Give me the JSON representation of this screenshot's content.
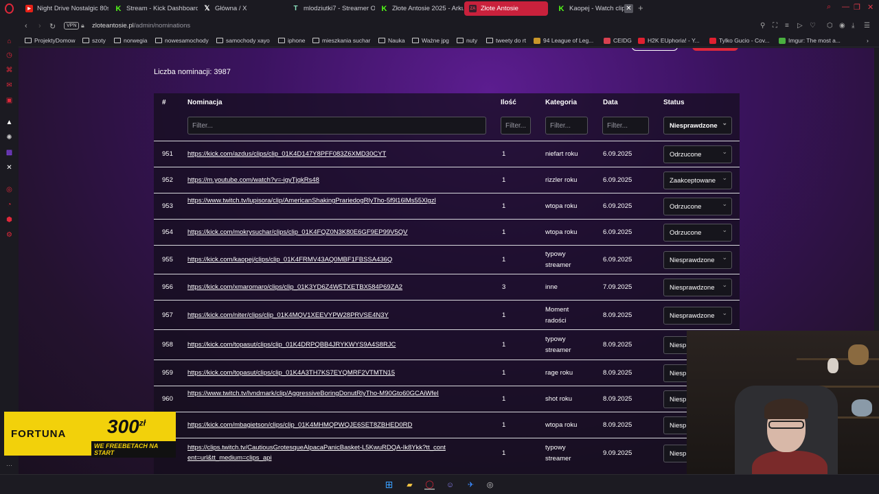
{
  "browser": {
    "tabs": [
      {
        "label": "Night Drive Nostalgic 80s",
        "favicon": "youtube-icon"
      },
      {
        "label": "Stream - Kick Dashboard",
        "favicon": "kick-icon"
      },
      {
        "label": "Główna / X",
        "favicon": "x-icon"
      },
      {
        "label": "mlodziutki7 - Streamer O",
        "favicon": "tt-icon"
      },
      {
        "label": "Złote Antosie 2025 - Arku",
        "favicon": "kick-icon"
      },
      {
        "label": "Złote Antosie",
        "favicon": "zlote-antosie-icon",
        "active": true
      },
      {
        "label": "Kaopej - Watch clips",
        "favicon": "kick-icon"
      }
    ],
    "vpn_label": "VPN",
    "url_host": "zloteantosie.pl",
    "url_path": "/admin/nominations",
    "accent_color": "#c9213c"
  },
  "bookmarks": [
    {
      "label": "ProjektyDomow",
      "type": "folder"
    },
    {
      "label": "szoty",
      "type": "folder"
    },
    {
      "label": "norwegia",
      "type": "folder"
    },
    {
      "label": "nowesamochody",
      "type": "folder"
    },
    {
      "label": "samochody xayo",
      "type": "folder"
    },
    {
      "label": "iphone",
      "type": "folder"
    },
    {
      "label": "mieszkania suchar",
      "type": "folder"
    },
    {
      "label": "Nauka",
      "type": "folder"
    },
    {
      "label": "Ważne jpg",
      "type": "folder"
    },
    {
      "label": "nuty",
      "type": "folder"
    },
    {
      "label": "tweety do rt",
      "type": "folder"
    },
    {
      "label": "94 League of Leg...",
      "type": "site"
    },
    {
      "label": "CEIDG",
      "type": "site"
    },
    {
      "label": "H2K EUphoria! - Y...",
      "type": "site"
    },
    {
      "label": "Tylko Gucio - Cov...",
      "type": "site"
    },
    {
      "label": "Imgur: The most a...",
      "type": "site"
    }
  ],
  "page": {
    "count_label": "Liczba nominacji: 3987",
    "headers": {
      "num": "#",
      "nomination": "Nominacja",
      "qty": "Ilość",
      "category": "Kategoria",
      "date": "Data",
      "status": "Status"
    },
    "filter_placeholder": "Filter...",
    "status_filter": "Niesprawdzone",
    "rows": [
      {
        "num": "951",
        "url": "https://kick.com/azdus/clips/clip_01K4D147Y8PFF083Z6XMD30CYT",
        "qty": "1",
        "category": "niefart roku",
        "date": "6.09.2025",
        "status": "Odrzucone"
      },
      {
        "num": "952",
        "url": "https://m.youtube.com/watch?v=-igyTjqkRs48",
        "qty": "1",
        "category": "rizzler roku",
        "date": "6.09.2025",
        "status": "Zaakceptowane"
      },
      {
        "num": "953",
        "url": "https://www.twitch.tv/lupisora/clip/AmericanShakingPrariedogRlyTho-5f9l16lMs55Xlgzl",
        "qty": "1",
        "category": "wtopa roku",
        "date": "6.09.2025",
        "status": "Odrzucone"
      },
      {
        "num": "954",
        "url": "https://kick.com/mokrysuchar/clips/clip_01K4FQZ0N3K80E6GF9EP99V5QV",
        "qty": "1",
        "category": "wtopa roku",
        "date": "6.09.2025",
        "status": "Odrzucone"
      },
      {
        "num": "955",
        "url": "https://kick.com/kaopej/clips/clip_01K4FRMV43AQ0MBF1FBSSA436Q",
        "qty": "1",
        "category": "typowy streamer",
        "date": "6.09.2025",
        "status": "Niesprawdzone"
      },
      {
        "num": "956",
        "url": "https://kick.com/xmaromaro/clips/clip_01K3YD6Z4W5TXETBX584P69ZA2",
        "qty": "3",
        "category": "inne",
        "date": "7.09.2025",
        "status": "Niesprawdzone"
      },
      {
        "num": "957",
        "url": "https://kick.com/niter/clips/clip_01K4MQV1XEEVYPW28PRVSE4N3Y",
        "qty": "1",
        "category": "Moment radości",
        "date": "8.09.2025",
        "status": "Niesprawdzone"
      },
      {
        "num": "958",
        "url": "https://kick.com/topasut/clips/clip_01K4DRPQBB4JRYKWYS9A4S8RJC",
        "qty": "1",
        "category": "typowy streamer",
        "date": "8.09.2025",
        "status": "Niesp"
      },
      {
        "num": "959",
        "url": "https://kick.com/topasut/clips/clip_01K4A3TH7KS7EYQMRF2VTMTN15",
        "qty": "1",
        "category": "rage roku",
        "date": "8.09.2025",
        "status": "Niesp"
      },
      {
        "num": "960",
        "url": "https://www.twitch.tv/lvndmark/clip/AggressiveBoringDonutRlyTho-M90Gto60GCAiWfeI",
        "qty": "1",
        "category": "shot roku",
        "date": "8.09.2025",
        "status": "Niesp"
      },
      {
        "num": "",
        "url": "https://kick.com/mbagietson/clips/clip_01K4MHMQPWQJE6SET8ZBHED0RD",
        "qty": "1",
        "category": "wtopa roku",
        "date": "8.09.2025",
        "status": "Niesp"
      },
      {
        "num": "",
        "url": "https://clips.twitch.tv/CautiousGrotesqueAlpacaPanicBasket-L5KwuRDQA-Ik8Ykk?tt_content=url&tt_medium=clips_api",
        "qty": "1",
        "category": "typowy streamer",
        "date": "9.09.2025",
        "status": "Niesp"
      }
    ]
  },
  "ad": {
    "brand": "FORTUNA",
    "amount": "300",
    "currency": "zł",
    "tagline": "WE FREEBETACH NA START"
  }
}
